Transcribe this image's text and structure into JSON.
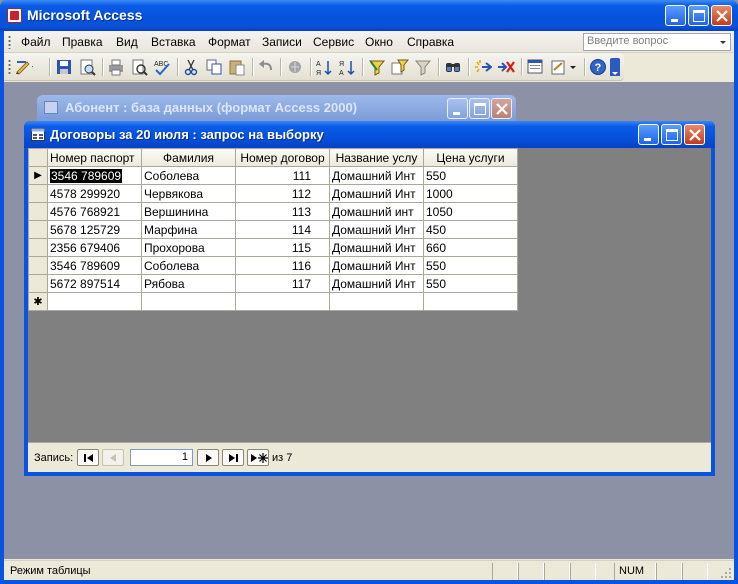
{
  "app": {
    "title": "Microsoft Access"
  },
  "menu": {
    "items": [
      "Файл",
      "Правка",
      "Вид",
      "Вставка",
      "Формат",
      "Записи",
      "Сервис",
      "Окно",
      "Справка"
    ],
    "help_placeholder": "Введите вопрос"
  },
  "toolbar": {
    "icons": [
      "design-view-icon",
      "save-icon",
      "file-search-icon",
      "print-icon",
      "print-preview-icon",
      "spelling-icon",
      "cut-icon",
      "copy-icon",
      "paste-icon",
      "undo-icon",
      "insert-hyperlink-icon",
      "sort-ascending-icon",
      "sort-descending-icon",
      "filter-by-selection-icon",
      "filter-by-form-icon",
      "apply-filter-icon",
      "find-icon",
      "new-record-icon",
      "delete-record-icon",
      "database-window-icon",
      "new-object-icon",
      "help-icon"
    ]
  },
  "db_window": {
    "title": "Абонент : база данных (формат Access 2000)"
  },
  "query_window": {
    "title": "Договоры за 20 июля : запрос на выборку",
    "columns": [
      "Номер паспорт",
      "Фамилия",
      "Номер договор",
      "Название услу",
      "Цена услуги"
    ],
    "rows": [
      [
        "3546 789609",
        "Соболева",
        "111",
        "Домашний Инт",
        "550"
      ],
      [
        "4578 299920",
        "Червякова",
        "112",
        "Домашний Инт",
        "1000"
      ],
      [
        "4576 768921",
        "Вершинина",
        "113",
        "Домашний инт",
        "1050"
      ],
      [
        "5678 125729",
        "Марфина",
        "114",
        "Домашний Инт",
        "450"
      ],
      [
        "2356 679406",
        "Прохорова",
        "115",
        "Домашний Инт",
        "660"
      ],
      [
        "3546 789609",
        "Соболева",
        "116",
        "Домашний Инт",
        "550"
      ],
      [
        "5672 897514",
        "Рябова",
        "117",
        "Домашний Инт",
        "550"
      ]
    ],
    "new_record_marker": "✱",
    "current_record_marker": "▶",
    "navigator": {
      "label": "Запись:",
      "current": "1",
      "of_text": "из  7"
    }
  },
  "status": {
    "mode": "Режим таблицы",
    "num": "NUM"
  }
}
